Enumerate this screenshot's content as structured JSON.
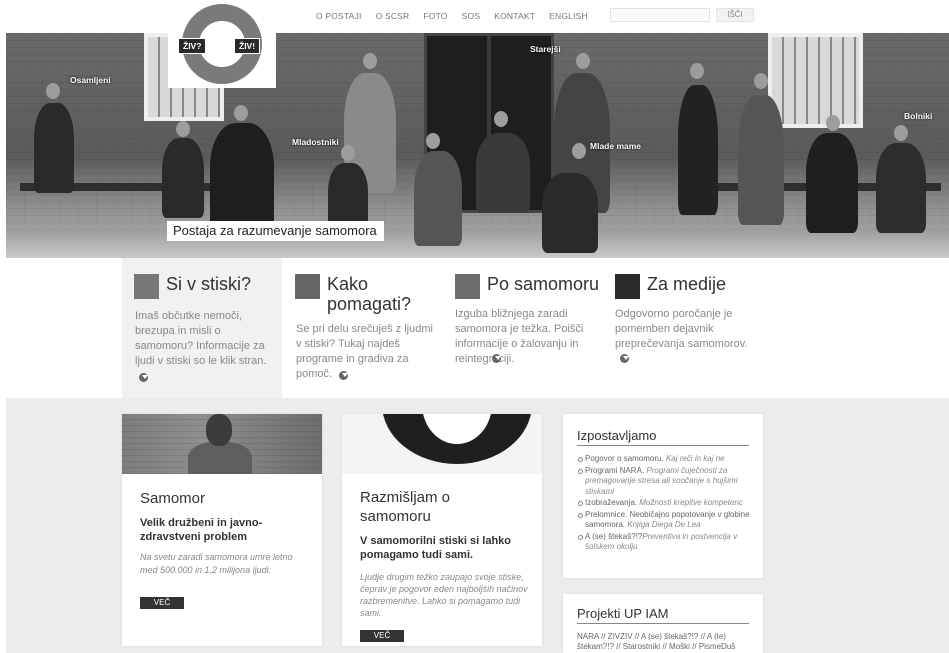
{
  "nav": {
    "items": [
      "O POSTAJI",
      "O SCSR",
      "FOTO",
      "SOS",
      "KONTAKT",
      "ENGLISH"
    ],
    "search_button": "IŠČI"
  },
  "logo": {
    "left_badge": "ŽIV?",
    "right_badge": "ŽIV!"
  },
  "hero": {
    "labels": [
      "Osamljeni",
      "Mladostniki",
      "Starejši",
      "Mlade mame",
      "Bolniki"
    ],
    "caption": "Postaja za razumevanje samomora"
  },
  "tiles": [
    {
      "title": "Si v stiski?",
      "text": "Imaš občutke nemoči, brezupa in misli o samomoru? Informacije za ljudi v stiski so le klik stran.",
      "color": "#777777"
    },
    {
      "title": "Kako pomagati?",
      "text": "Se pri delu srečuješ z ljudmi v stiski? Tukaj najdeš programe in gradiva za pomoč.",
      "color": "#666666"
    },
    {
      "title": "Po samomoru",
      "text": "Izguba bližnjega zaradi samomora je težka. Poišči informacije o žalovanju in reintegraciji.",
      "color": "#6d6d6d"
    },
    {
      "title": "Za medije",
      "text": "Odgovorno poročanje je pomemben dejavnik preprečevanja samomorov.",
      "color": "#2a2a2a"
    }
  ],
  "cards": {
    "samomor": {
      "title": "Samomor",
      "subtitle": "Velik družbeni in javno-zdravstveni problem",
      "text": "Na svetu zaradi samomora umre letno med 500.000 in 1,2 milijona ljudi.",
      "button": "VEČ"
    },
    "razmisljam": {
      "title": "Razmišljam o samomoru",
      "subtitle": "V samomorilni stiski si lahko pomagamo tudi sami.",
      "text": "Ljudje drugim težko zaupajo svoje stiske, čeprav je pogovor eden najboljših načinov razbremenitve. Lahko si pomagamo tudi sami.",
      "button": "VEČ"
    },
    "izpostavljamo": {
      "title": "Izpostavljamo",
      "items": [
        {
          "main": "Pogovor o samomoru.",
          "italic": "Kaj reči in kaj ne"
        },
        {
          "main": "Programi NARA.",
          "italic": "Programi čuječnosti za premagovanje stresa ali soočanje s hujšimi stiskami"
        },
        {
          "main": "Izobraževanja.",
          "italic": "Možnosti krepitve kompetenc"
        },
        {
          "main": "Prelomnice. Neobičajno popotovanje v globine samomora.",
          "italic": "Knjiga Diega De Lea"
        },
        {
          "main": "A (se) štekaš?!?",
          "italic": "Preventiva in postvencija v šolskem okolju"
        }
      ]
    },
    "projekti": {
      "title": "Projekti UP IAM",
      "text": "NARA // ZIVZIV // A (se) štekaš?!? // A (te) štekam?!? // Starostniki // Moški // PismeDuš"
    }
  }
}
